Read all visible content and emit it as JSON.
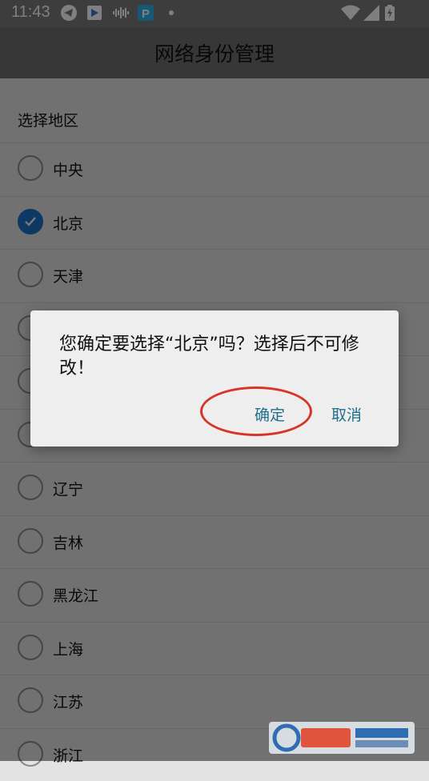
{
  "status_bar": {
    "time": "11:43",
    "icons": [
      "telegram-icon",
      "app-store-icon",
      "audio-wave-icon",
      "p-app-icon",
      "dot-icon",
      "wifi-icon",
      "signal-icon",
      "battery-charging-icon"
    ]
  },
  "header": {
    "title": "网络身份管理"
  },
  "section": {
    "label": "选择地区"
  },
  "regions": [
    {
      "label": "中央",
      "checked": false
    },
    {
      "label": "北京",
      "checked": true
    },
    {
      "label": "天津",
      "checked": false
    },
    {
      "label": "",
      "checked": false
    },
    {
      "label": "",
      "checked": false
    },
    {
      "label": "",
      "checked": false
    },
    {
      "label": "辽宁",
      "checked": false
    },
    {
      "label": "吉林",
      "checked": false
    },
    {
      "label": "黑龙江",
      "checked": false
    },
    {
      "label": "上海",
      "checked": false
    },
    {
      "label": "江苏",
      "checked": false
    },
    {
      "label": "浙江",
      "checked": false
    }
  ],
  "dialog": {
    "message": "您确定要选择“北京”吗？选择后不可修改！",
    "confirm_label": "确定",
    "cancel_label": "取消"
  },
  "colors": {
    "accent": "#1a73c8",
    "dialog_button": "#1d6f8c",
    "annotation": "#d8352a"
  }
}
